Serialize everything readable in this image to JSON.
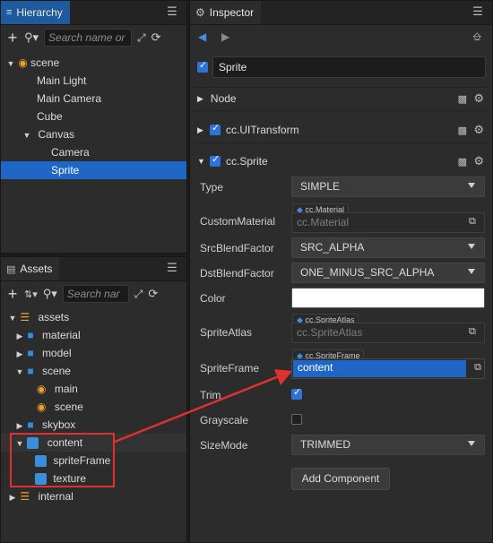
{
  "hierarchy": {
    "tab_label": "Hierarchy",
    "search_placeholder": "Search name or",
    "tree": [
      {
        "label": "scene"
      },
      {
        "label": "Main Light"
      },
      {
        "label": "Main Camera"
      },
      {
        "label": "Cube"
      },
      {
        "label": "Canvas"
      },
      {
        "label": "Camera"
      },
      {
        "label": "Sprite"
      }
    ]
  },
  "assets": {
    "tab_label": "Assets",
    "search_placeholder": "Search nar",
    "tree": [
      {
        "label": "assets"
      },
      {
        "label": "material"
      },
      {
        "label": "model"
      },
      {
        "label": "scene"
      },
      {
        "label": "main"
      },
      {
        "label": "scene"
      },
      {
        "label": "skybox"
      },
      {
        "label": "content"
      },
      {
        "label": "spriteFrame"
      },
      {
        "label": "texture"
      },
      {
        "label": "internal"
      }
    ]
  },
  "inspector": {
    "tab_label": "Inspector",
    "node_name": "Sprite",
    "sections": {
      "node": "Node",
      "uitransform": "cc.UITransform",
      "sprite": "cc.Sprite"
    },
    "props": {
      "type_label": "Type",
      "type_value": "SIMPLE",
      "custom_material_label": "CustomMaterial",
      "custom_material_tag": "cc.Material",
      "custom_material_value": "cc.Material",
      "src_blend_label": "SrcBlendFactor",
      "src_blend_value": "SRC_ALPHA",
      "dst_blend_label": "DstBlendFactor",
      "dst_blend_value": "ONE_MINUS_SRC_ALPHA",
      "color_label": "Color",
      "sprite_atlas_label": "SpriteAtlas",
      "sprite_atlas_tag": "cc.SpriteAtlas",
      "sprite_atlas_value": "cc.SpriteAtlas",
      "sprite_frame_label": "SpriteFrame",
      "sprite_frame_tag": "cc.SpriteFrame",
      "sprite_frame_value": "content",
      "trim_label": "Trim",
      "grayscale_label": "Grayscale",
      "size_mode_label": "SizeMode",
      "size_mode_value": "TRIMMED"
    },
    "add_component_label": "Add Component"
  },
  "colors": {
    "accent": "#1f66c7",
    "annotation": "#e03030"
  }
}
